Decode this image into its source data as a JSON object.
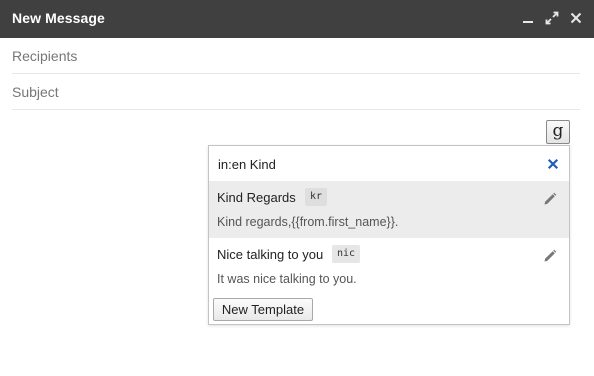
{
  "window": {
    "title": "New Message",
    "controls": [
      "minimize-icon",
      "expand-icon",
      "close-icon"
    ]
  },
  "compose": {
    "recipients_placeholder": "Recipients",
    "subject_placeholder": "Subject"
  },
  "toolbar": {
    "template_button_label": "g"
  },
  "template_popup": {
    "search_value": "in:en Kind",
    "clear_icon": "close-icon",
    "templates": [
      {
        "name": "Kind Regards",
        "shortcut": "kr",
        "preview": "Kind regards,{{from.first_name}}.",
        "edit_icon": "pencil-icon",
        "selected": true
      },
      {
        "name": "Nice talking to you",
        "shortcut": "nic",
        "preview": "It was nice talking to you.",
        "edit_icon": "pencil-icon",
        "selected": false
      }
    ],
    "new_template_label": "New Template"
  },
  "colors": {
    "titlebar_bg": "#404040",
    "clear_icon": "#1f5fb3",
    "selected_row_bg": "#ececec"
  }
}
